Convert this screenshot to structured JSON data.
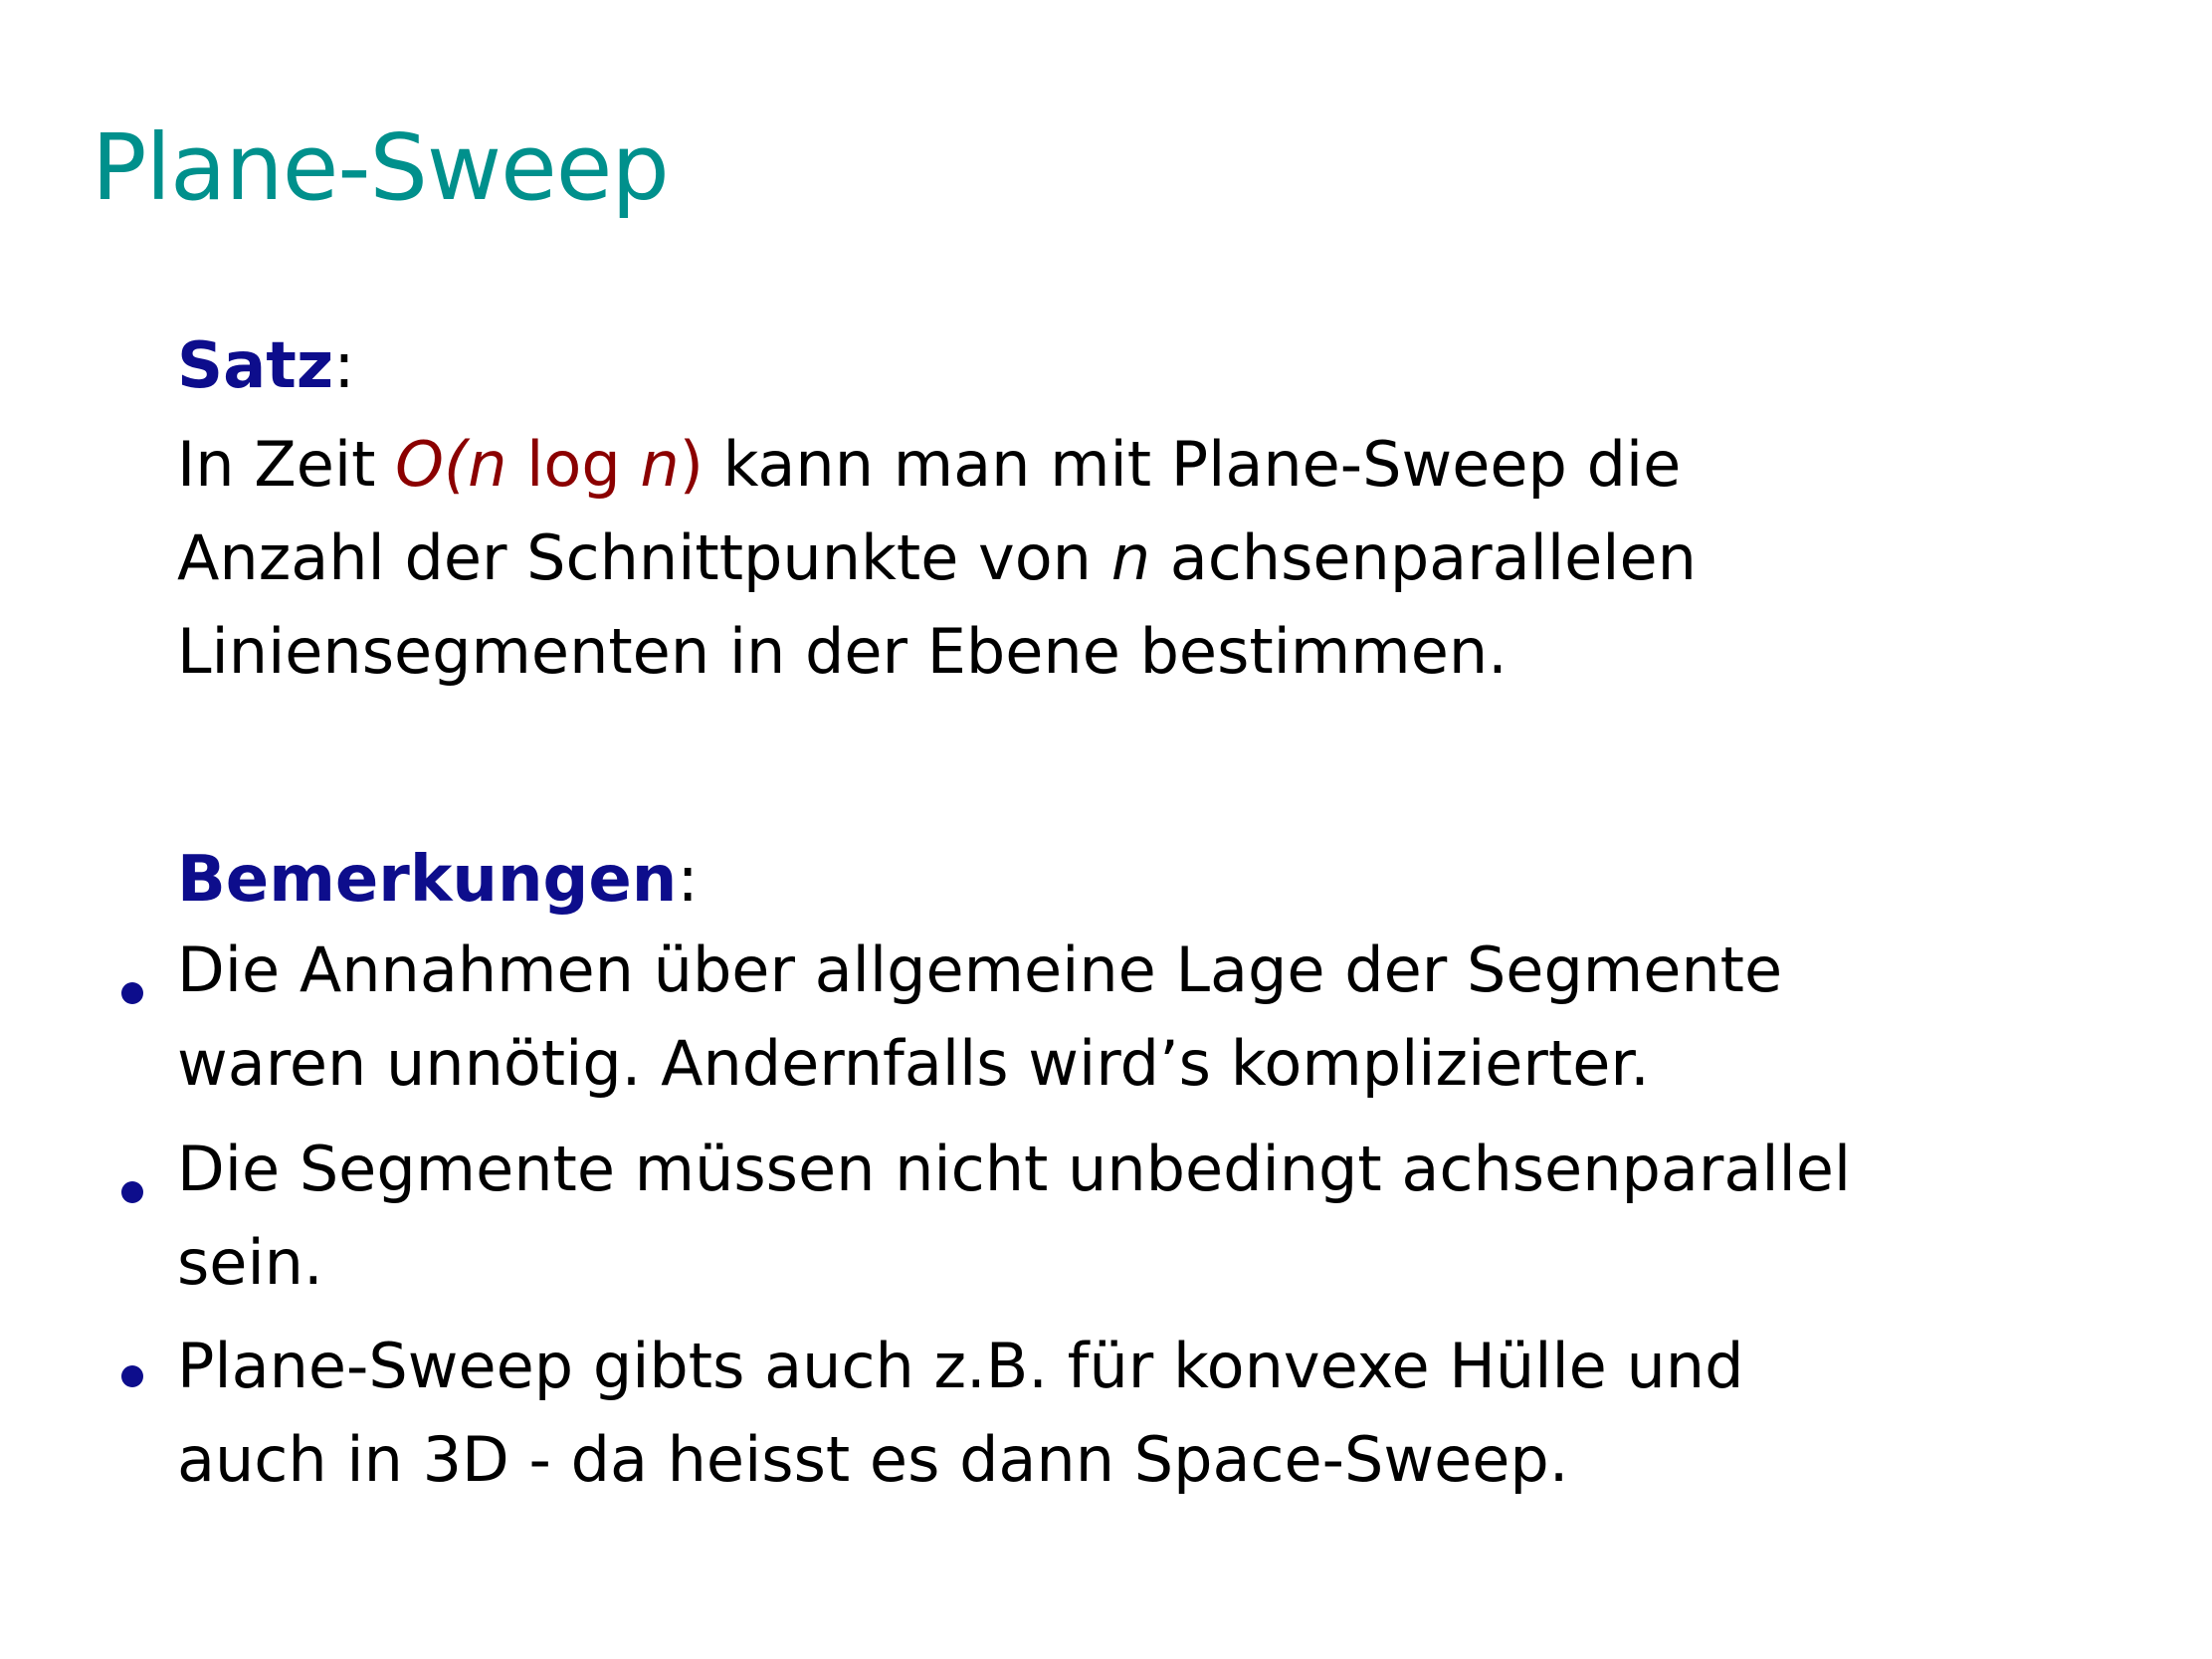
{
  "colors": {
    "title": "#00908c",
    "heading": "#0d0d8c",
    "math": "#8b0000",
    "text": "#000000"
  },
  "title": "Plane-Sweep",
  "satz": {
    "heading": "Satz",
    "colon": ":",
    "line1_pre": "In Zeit ",
    "math_O": "O(",
    "math_n1": "n",
    "math_log": " log ",
    "math_n2": "n",
    "math_close": ")",
    "line1_post": " kann man mit Plane-Sweep die",
    "line2_pre": "Anzahl der Schnittpunkte von ",
    "line2_n": "n",
    "line2_post": " achsenparallelen",
    "line3": "Liniensegmenten in der Ebene bestimmen."
  },
  "bemerkungen": {
    "heading": "Bemerkungen",
    "colon": ":",
    "items": [
      {
        "line1": "Die Annahmen über allgemeine Lage der Segmente",
        "line2": "waren unnötig. Andernfalls wird’s komplizierter."
      },
      {
        "line1": "Die Segmente müssen nicht unbedingt achsenparallel",
        "line2": "sein."
      },
      {
        "line1": "Plane-Sweep gibts auch z.B. für konvexe Hülle und",
        "line2": "auch in 3D - da heisst es dann Space-Sweep."
      }
    ]
  }
}
